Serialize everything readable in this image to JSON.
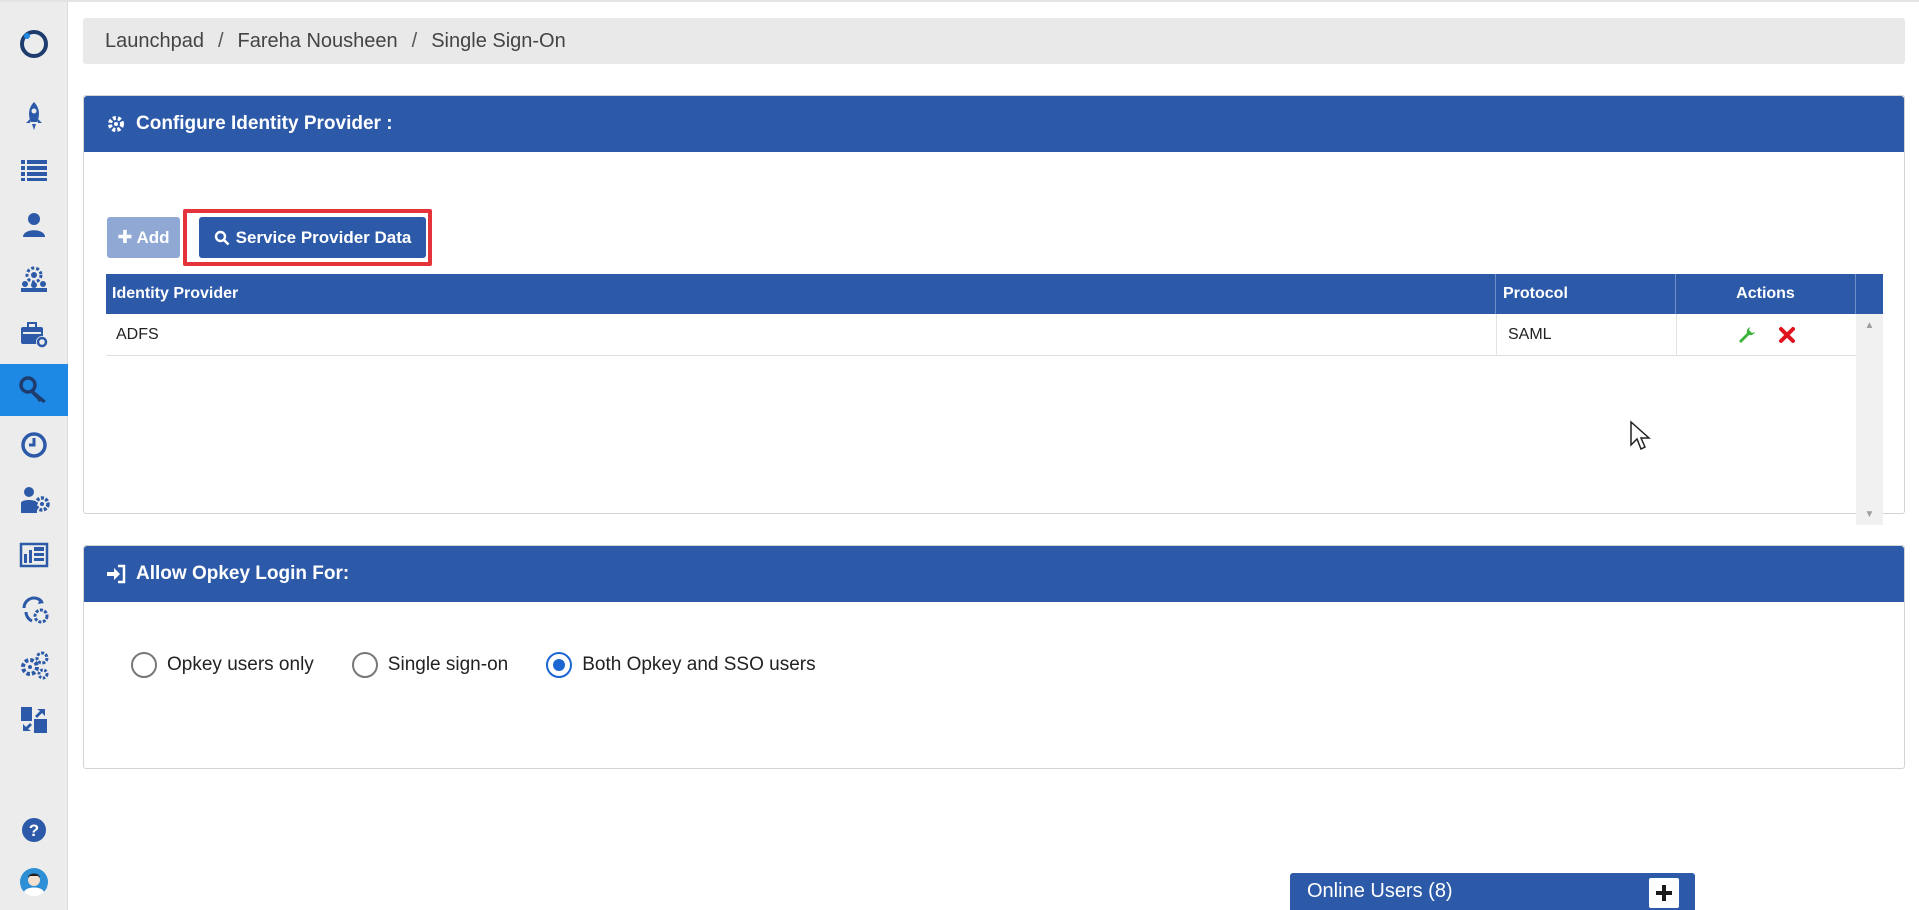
{
  "breadcrumb": {
    "items": [
      "Launchpad",
      "Fareha Nousheen",
      "Single Sign-On"
    ],
    "separator": "/"
  },
  "sidebar": {
    "items": [
      {
        "icon": "logo-ring-icon"
      },
      {
        "icon": "rocket-icon"
      },
      {
        "icon": "list-icon"
      },
      {
        "icon": "user-icon"
      },
      {
        "icon": "users-gear-icon"
      },
      {
        "icon": "briefcase-settings-icon"
      },
      {
        "icon": "key-icon",
        "active": true
      },
      {
        "icon": "clock-icon"
      },
      {
        "icon": "user-gear-icon"
      },
      {
        "icon": "report-icon"
      },
      {
        "icon": "sync-settings-icon"
      },
      {
        "icon": "gears-icon"
      },
      {
        "icon": "export-icon"
      },
      {
        "icon": "help-icon"
      },
      {
        "icon": "avatar-icon"
      }
    ]
  },
  "identity_panel": {
    "title": "Configure Identity Provider :",
    "add_label": "Add",
    "service_provider_label": "Service Provider Data",
    "columns": [
      "Identity Provider",
      "Protocol",
      "Actions"
    ],
    "rows": [
      {
        "provider": "ADFS",
        "protocol": "SAML"
      }
    ]
  },
  "login_panel": {
    "title": "Allow Opkey Login For:",
    "options": [
      "Opkey users only",
      "Single sign-on",
      "Both Opkey and SSO users"
    ],
    "selected": "Both Opkey and SSO users"
  },
  "online_users": {
    "label": "Online Users (8)"
  },
  "colors": {
    "primary": "#2d5aa8",
    "active_nav": "#1e88e5",
    "highlight": "#e5333b",
    "edit": "#3bb33b",
    "delete": "#e0141e"
  }
}
